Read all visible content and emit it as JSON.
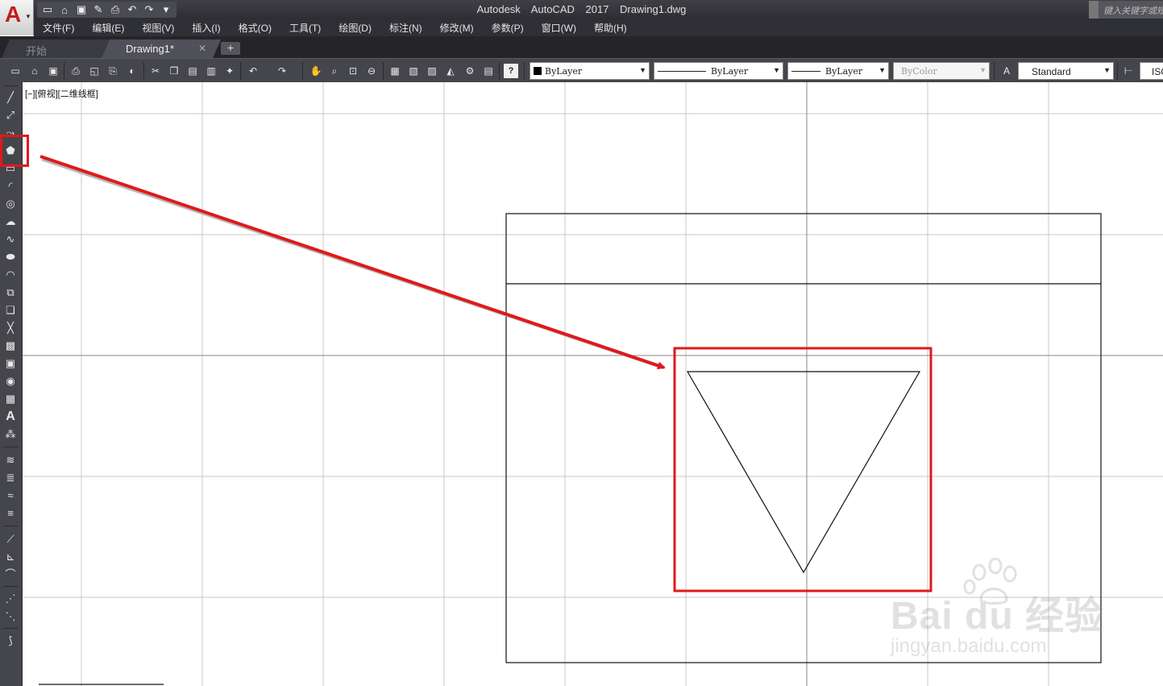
{
  "titlebar": {
    "title": "Autodesk AutoCAD 2017    Drawing1.dwg",
    "search_placeholder": "键入关键字或短语",
    "app_button_glyph": "A"
  },
  "qat_icons": [
    "new-icon",
    "open-icon",
    "save-icon",
    "saveas-icon",
    "print-icon",
    "undo-icon",
    "redo-icon",
    "workspace-icon"
  ],
  "menubar": {
    "items": [
      "文件(F)",
      "编辑(E)",
      "视图(V)",
      "插入(I)",
      "格式(O)",
      "工具(T)",
      "绘图(D)",
      "标注(N)",
      "修改(M)",
      "参数(P)",
      "窗口(W)",
      "帮助(H)"
    ]
  },
  "tabs": {
    "items": [
      {
        "label": "开始",
        "active": false
      },
      {
        "label": "Drawing1*",
        "active": true
      }
    ],
    "add_label": "+"
  },
  "toolbar": {
    "color_value": "ByLayer",
    "linetype_value": "ByLayer",
    "lineweight_value": "ByLayer",
    "plotstyle_value": "ByColor",
    "textstyle_value": "Standard",
    "dimstyle_value": "ISO"
  },
  "canvas": {
    "viewport_label": "[−][俯视][二维线框]"
  },
  "watermark": {
    "logo_text": "Bai du 经验",
    "site_text": "jingyan.baidu.com"
  },
  "colors": {
    "highlight": "#e0191b",
    "grid": "#c8c8c8",
    "ui_dark": "#45454c"
  }
}
